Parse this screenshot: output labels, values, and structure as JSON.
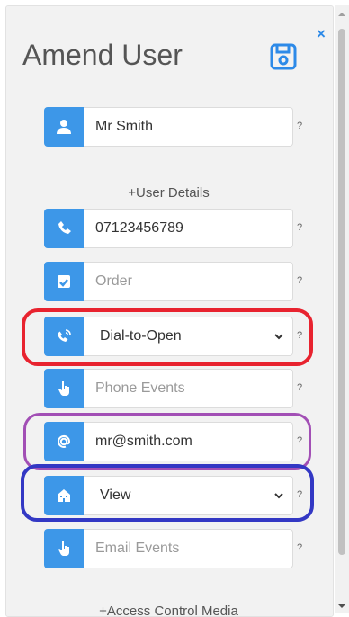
{
  "window": {
    "close_glyph": "×"
  },
  "header": {
    "title": "Amend User",
    "save_icon": "floppy-disk-icon"
  },
  "fields": {
    "name": {
      "value": "Mr Smith",
      "icon": "user-icon",
      "help": "?"
    },
    "section_user_details": "+User Details",
    "phone": {
      "value": "07123456789",
      "icon": "phone-icon",
      "help": "?"
    },
    "order": {
      "placeholder": "Order",
      "icon": "order-icon",
      "help": "?"
    },
    "dial_mode": {
      "value": "Dial-to-Open",
      "icon": "phone-volume-icon",
      "help": "?"
    },
    "phone_events": {
      "placeholder": "Phone Events",
      "icon": "hand-pointer-icon",
      "help": "?"
    },
    "email": {
      "value": "mr@smith.com",
      "icon": "at-icon",
      "help": "?"
    },
    "email_access": {
      "value": "View",
      "icon": "building-icon",
      "help": "?"
    },
    "email_events": {
      "placeholder": "Email Events",
      "icon": "hand-pointer-icon",
      "help": "?"
    },
    "section_access_control": "+Access Control Media"
  },
  "colors": {
    "accent": "#3d97e8",
    "highlight_red": "#e8232f",
    "highlight_purple": "#a24fb5",
    "highlight_blue": "#3338c4"
  }
}
